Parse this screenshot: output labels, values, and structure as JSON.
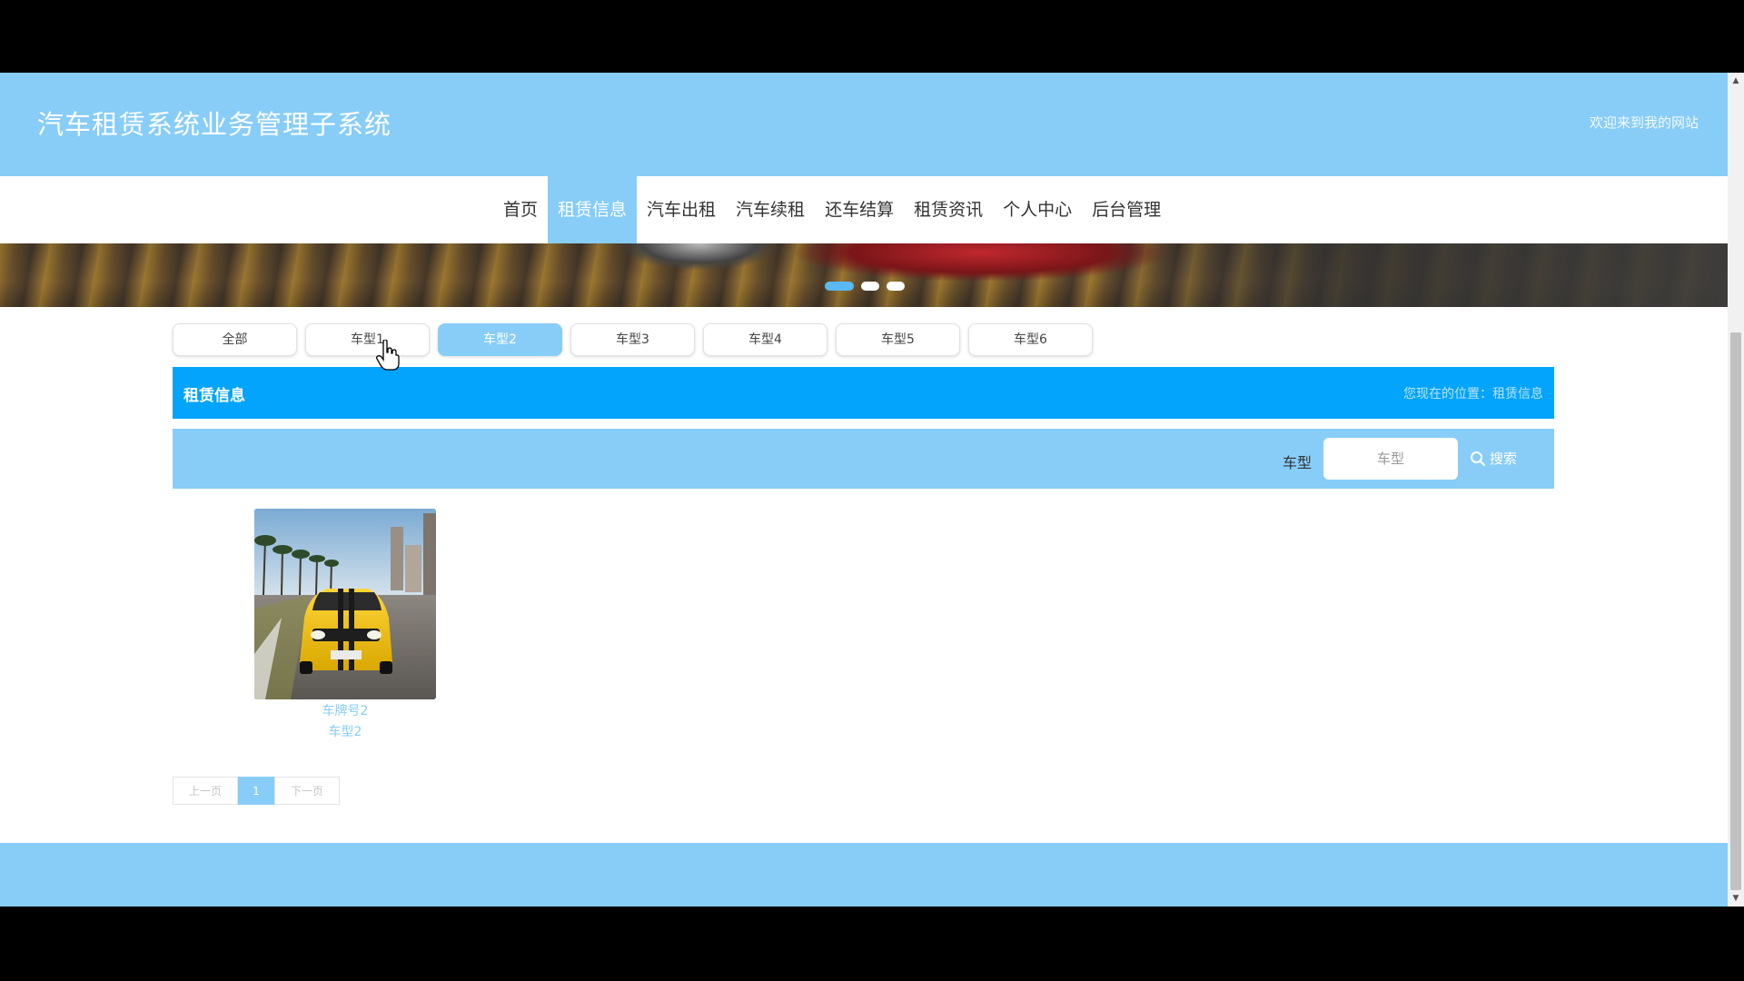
{
  "header": {
    "title": "汽车租赁系统业务管理子系统",
    "welcome": "欢迎来到我的网站"
  },
  "nav": {
    "items": [
      {
        "label": "首页",
        "active": false
      },
      {
        "label": "租赁信息",
        "active": true
      },
      {
        "label": "汽车出租",
        "active": false
      },
      {
        "label": "汽车续租",
        "active": false
      },
      {
        "label": "还车结算",
        "active": false
      },
      {
        "label": "租赁资讯",
        "active": false
      },
      {
        "label": "个人中心",
        "active": false
      },
      {
        "label": "后台管理",
        "active": false
      }
    ]
  },
  "banner": {
    "slides": 3,
    "active_slide": 1
  },
  "categories": {
    "items": [
      "全部",
      "车型1",
      "车型2",
      "车型3",
      "车型4",
      "车型5",
      "车型6"
    ],
    "active": "车型2"
  },
  "section": {
    "title": "租赁信息",
    "breadcrumb": "您现在的位置：租赁信息"
  },
  "search": {
    "label": "车型",
    "placeholder": "车型",
    "button_label": "搜索"
  },
  "cards": [
    {
      "plate": "车牌号2",
      "model": "车型2",
      "image": "yellow-sports-car"
    }
  ],
  "pagination": {
    "prev_label": "上一页",
    "current_page": "1",
    "next_label": "下一页"
  },
  "colors": {
    "header_bg": "#87cdf8",
    "section_bar": "#03a4fb",
    "active_tab": "#87cdf8",
    "footer_bg": "#87cdf8"
  }
}
